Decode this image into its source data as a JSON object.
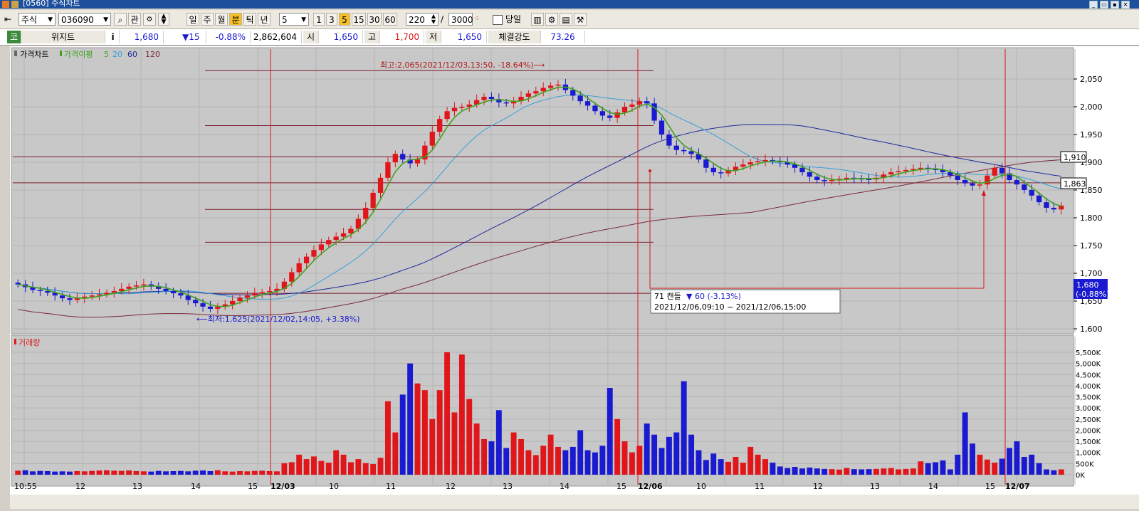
{
  "window": {
    "title": "[0560] 주식차트"
  },
  "toolbar": {
    "market": "주식",
    "code": "036090",
    "btn_search": "⌕",
    "btn_gwan": "관",
    "periods": [
      "일",
      "주",
      "월",
      "분",
      "틱",
      "년"
    ],
    "selected_period": "분",
    "interval_value": "5",
    "intervals": [
      "1",
      "3",
      "5",
      "15",
      "30",
      "60"
    ],
    "selected_interval": "5",
    "count_value": "220",
    "separator": "/",
    "total_value": "3000",
    "same_day_label": "당일"
  },
  "quote": {
    "code_tag": "코",
    "name": "위지트",
    "info_icon": "i",
    "price": "1,680",
    "change": "▼15",
    "change_pct": "-0.88%",
    "volume": "2,862,604",
    "open_label": "시",
    "open": "1,650",
    "high_label": "고",
    "high": "1,700",
    "low_label": "저",
    "low": "1,650",
    "strength_label": "체결강도",
    "strength": "73.26"
  },
  "chart": {
    "price_panel_title": "가격차트",
    "ma_label": "가격이평",
    "ma_periods": [
      "5",
      "20",
      "60",
      "120"
    ],
    "volume_panel_title": "거래량",
    "high_annotation": "최고:2,065(2021/12/03,13:50, -18.64%)⟶",
    "low_annotation": "⟵최저:1,625(2021/12/02,14:05, +3.38%)",
    "tooltip_line1_a": "71 캔들",
    "tooltip_line1_b": "▼ 60 (-3.13%)",
    "tooltip_line2": "2021/12/06,09:10 ~ 2021/12/06,15:00",
    "current_price_tag": "1,680",
    "current_pct_tag": "(-0.88%)",
    "level_tag_1": "1,910",
    "level_tag_2": "1,863",
    "colors": {
      "up": "#e0161a",
      "down": "#1a1ad0",
      "ma5": "#3fa11c",
      "ma20": "#35a0d8",
      "ma60": "#1a2a9a",
      "ma120": "#7a2a3a",
      "bg": "#c8c8c8"
    }
  },
  "chart_data": {
    "type": "candlestick",
    "price_axis_ticks": [
      "2,050",
      "2,000",
      "1,950",
      "1,900",
      "1,850",
      "1,800",
      "1,750",
      "1,700",
      "1,650",
      "1,600"
    ],
    "volume_axis_ticks": [
      "5,500K",
      "5,000K",
      "4,500K",
      "4,000K",
      "3,500K",
      "3,000K",
      "2,500K",
      "2,000K",
      "1,500K",
      "1,000K",
      "500K",
      "0K"
    ],
    "x_ticks": [
      "10:55",
      "12",
      "13",
      "14",
      "15",
      "12/03",
      "10",
      "11",
      "12",
      "13",
      "14",
      "15",
      "12/06",
      "10",
      "11",
      "12",
      "13",
      "14",
      "15",
      "12/07"
    ],
    "date_separators": [
      "12/03",
      "12/06",
      "12/07"
    ],
    "price_range": [
      1600,
      2070
    ],
    "volume_range": [
      0,
      5800
    ],
    "high": 2065,
    "low": 1625,
    "ma5_last": 1822,
    "ma20_last": 1845,
    "ma60_last": 1870,
    "ma120_last": 1905,
    "close_series": [
      1680,
      1675,
      1670,
      1668,
      1665,
      1660,
      1655,
      1652,
      1655,
      1658,
      1660,
      1662,
      1665,
      1668,
      1672,
      1676,
      1678,
      1680,
      1676,
      1672,
      1668,
      1664,
      1660,
      1652,
      1646,
      1640,
      1636,
      1640,
      1644,
      1650,
      1656,
      1660,
      1664,
      1666,
      1668,
      1672,
      1685,
      1702,
      1718,
      1730,
      1742,
      1752,
      1760,
      1766,
      1772,
      1780,
      1798,
      1818,
      1845,
      1872,
      1900,
      1915,
      1905,
      1898,
      1905,
      1930,
      1955,
      1978,
      1992,
      1998,
      2000,
      2004,
      2012,
      2018,
      2014,
      2008,
      2006,
      2010,
      2018,
      2024,
      2028,
      2034,
      2038,
      2040,
      2030,
      2020,
      2010,
      2002,
      1992,
      1984,
      1980,
      1990,
      2000,
      2004,
      2010,
      2006,
      1975,
      1950,
      1930,
      1922,
      1920,
      1915,
      1905,
      1890,
      1882,
      1880,
      1886,
      1892,
      1896,
      1900,
      1902,
      1904,
      1902,
      1900,
      1896,
      1890,
      1882,
      1874,
      1868,
      1866,
      1868,
      1870,
      1872,
      1871,
      1870,
      1869,
      1872,
      1878,
      1882,
      1884,
      1886,
      1888,
      1890,
      1889,
      1886,
      1882,
      1876,
      1868,
      1862,
      1858,
      1860,
      1876,
      1890,
      1880,
      1868,
      1860,
      1850,
      1840,
      1828,
      1818,
      1815,
      1822
    ],
    "volume_series": [
      180,
      200,
      150,
      170,
      160,
      140,
      150,
      140,
      160,
      150,
      170,
      190,
      200,
      180,
      170,
      190,
      160,
      150,
      140,
      170,
      150,
      160,
      170,
      150,
      180,
      190,
      160,
      200,
      150,
      140,
      160,
      150,
      170,
      180,
      160,
      150,
      520,
      560,
      900,
      700,
      820,
      620,
      540,
      1100,
      900,
      560,
      700,
      520,
      480,
      760,
      3300,
      1900,
      3600,
      5000,
      4100,
      3800,
      2500,
      3800,
      5500,
      2800,
      5400,
      3400,
      2300,
      1600,
      1500,
      2900,
      1200,
      1900,
      1600,
      1100,
      880,
      1300,
      1800,
      1250,
      1100,
      1250,
      2000,
      1100,
      1000,
      1300,
      3900,
      2500,
      1500,
      1000,
      1300,
      2300,
      1800,
      1200,
      1700,
      1900,
      4200,
      1800,
      1100,
      660,
      950,
      700,
      580,
      800,
      540,
      1250,
      900,
      700,
      540,
      370,
      300,
      350,
      280,
      320,
      280,
      260,
      250,
      230,
      300,
      250,
      240,
      250,
      260,
      280,
      300,
      240,
      260,
      280,
      600,
      520,
      560,
      640,
      240,
      900,
      2800,
      1400,
      900,
      680,
      540,
      720,
      1200,
      1500,
      800,
      900,
      520,
      240,
      200,
      240
    ]
  }
}
